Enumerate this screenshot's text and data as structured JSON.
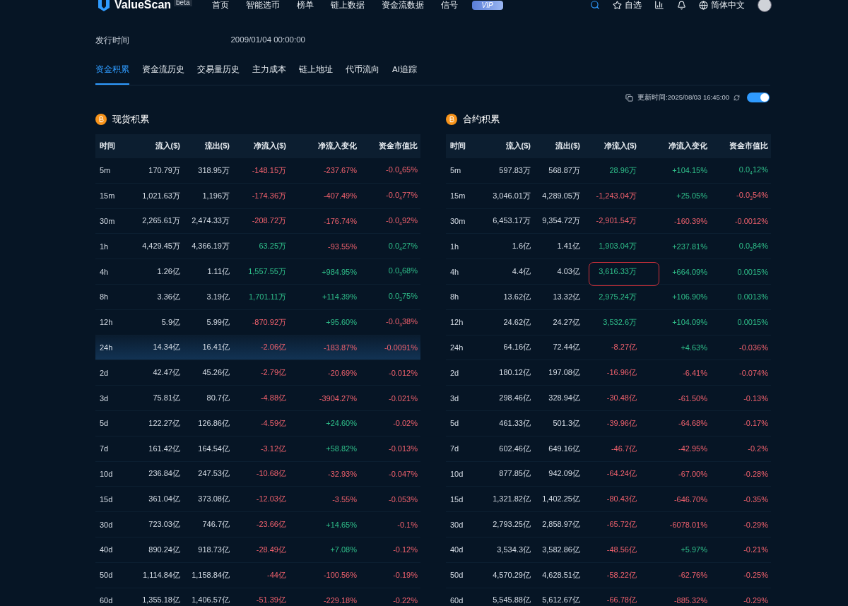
{
  "nav": {
    "brand": "ValueScan",
    "badge": "beta",
    "items": [
      {
        "label": "首页",
        "selected": false
      },
      {
        "label": "智能选币",
        "selected": false
      },
      {
        "label": "榜单",
        "selected": false
      },
      {
        "label": "链上数据",
        "selected": false
      },
      {
        "label": "资金流数据",
        "selected": false
      },
      {
        "label": "信号",
        "selected": false
      }
    ],
    "vip": "VIP",
    "watchlist": "自选",
    "language": "简体中文"
  },
  "info": {
    "label": "发行时间",
    "value": "2009/01/04 00:00:00"
  },
  "tabs": [
    {
      "label": "资金积累",
      "selected": true
    },
    {
      "label": "资金流历史",
      "selected": false
    },
    {
      "label": "交易量历史",
      "selected": false
    },
    {
      "label": "主力成本",
      "selected": false
    },
    {
      "label": "链上地址",
      "selected": false
    },
    {
      "label": "代币流向",
      "selected": false
    },
    {
      "label": "AI追踪",
      "selected": false
    }
  ],
  "update": {
    "text": "更新时间:2025/08/03 16:45:00",
    "auto_refresh": true
  },
  "tables": [
    {
      "title": "现货积累",
      "columns": [
        "时间",
        "流入($)",
        "流出($)",
        "净流入($)",
        "净流入变化",
        "资金市值比"
      ],
      "rows": [
        {
          "time": "5m",
          "inflow": "170.79万",
          "outflow": "318.95万",
          "net": "-148.15万",
          "net_up": false,
          "change": "-237.67%",
          "change_up": false,
          "ratio": "-0.0$_{4}$65%",
          "ratio_up": false,
          "selected": false,
          "circled": false
        },
        {
          "time": "15m",
          "inflow": "1,021.63万",
          "outflow": "1,196万",
          "net": "-174.36万",
          "net_up": false,
          "change": "-407.49%",
          "change_up": false,
          "ratio": "-0.0$_{4}$77%",
          "ratio_up": false,
          "selected": false,
          "circled": false
        },
        {
          "time": "30m",
          "inflow": "2,265.61万",
          "outflow": "2,474.33万",
          "net": "-208.72万",
          "net_up": false,
          "change": "-176.74%",
          "change_up": false,
          "ratio": "-0.0$_{4}$92%",
          "ratio_up": false,
          "selected": false,
          "circled": false
        },
        {
          "time": "1h",
          "inflow": "4,429.45万",
          "outflow": "4,366.19万",
          "net": "63.25万",
          "net_up": true,
          "change": "-93.55%",
          "change_up": false,
          "ratio": "0.0$_{4}$27%",
          "ratio_up": true,
          "selected": false,
          "circled": false
        },
        {
          "time": "4h",
          "inflow": "1.26亿",
          "outflow": "1.11亿",
          "net": "1,557.55万",
          "net_up": true,
          "change": "+984.95%",
          "change_up": true,
          "ratio": "0.0$_{3}$68%",
          "ratio_up": true,
          "selected": false,
          "circled": false
        },
        {
          "time": "8h",
          "inflow": "3.36亿",
          "outflow": "3.19亿",
          "net": "1,701.11万",
          "net_up": true,
          "change": "+114.39%",
          "change_up": true,
          "ratio": "0.0$_{3}$75%",
          "ratio_up": true,
          "selected": false,
          "circled": false
        },
        {
          "time": "12h",
          "inflow": "5.9亿",
          "outflow": "5.99亿",
          "net": "-870.92万",
          "net_up": false,
          "change": "+95.60%",
          "change_up": true,
          "ratio": "-0.0$_{3}$38%",
          "ratio_up": false,
          "selected": false,
          "circled": false
        },
        {
          "time": "24h",
          "inflow": "14.34亿",
          "outflow": "16.41亿",
          "net": "-2.06亿",
          "net_up": false,
          "change": "-183.87%",
          "change_up": false,
          "ratio": "-0.0091%",
          "ratio_up": false,
          "selected": true,
          "circled": false
        },
        {
          "time": "2d",
          "inflow": "42.47亿",
          "outflow": "45.26亿",
          "net": "-2.79亿",
          "net_up": false,
          "change": "-20.69%",
          "change_up": false,
          "ratio": "-0.012%",
          "ratio_up": false,
          "selected": false,
          "circled": false
        },
        {
          "time": "3d",
          "inflow": "75.81亿",
          "outflow": "80.7亿",
          "net": "-4.88亿",
          "net_up": false,
          "change": "-3904.27%",
          "change_up": false,
          "ratio": "-0.021%",
          "ratio_up": false,
          "selected": false,
          "circled": false
        },
        {
          "time": "5d",
          "inflow": "122.27亿",
          "outflow": "126.86亿",
          "net": "-4.59亿",
          "net_up": false,
          "change": "+24.60%",
          "change_up": true,
          "ratio": "-0.02%",
          "ratio_up": false,
          "selected": false,
          "circled": false
        },
        {
          "time": "7d",
          "inflow": "161.42亿",
          "outflow": "164.54亿",
          "net": "-3.12亿",
          "net_up": false,
          "change": "+58.82%",
          "change_up": true,
          "ratio": "-0.013%",
          "ratio_up": false,
          "selected": false,
          "circled": false
        },
        {
          "time": "10d",
          "inflow": "236.84亿",
          "outflow": "247.53亿",
          "net": "-10.68亿",
          "net_up": false,
          "change": "-32.93%",
          "change_up": false,
          "ratio": "-0.047%",
          "ratio_up": false,
          "selected": false,
          "circled": false
        },
        {
          "time": "15d",
          "inflow": "361.04亿",
          "outflow": "373.08亿",
          "net": "-12.03亿",
          "net_up": false,
          "change": "-3.55%",
          "change_up": false,
          "ratio": "-0.053%",
          "ratio_up": false,
          "selected": false,
          "circled": false
        },
        {
          "time": "30d",
          "inflow": "723.03亿",
          "outflow": "746.7亿",
          "net": "-23.66亿",
          "net_up": false,
          "change": "+14.65%",
          "change_up": true,
          "ratio": "-0.1%",
          "ratio_up": false,
          "selected": false,
          "circled": false
        },
        {
          "time": "40d",
          "inflow": "890.24亿",
          "outflow": "918.73亿",
          "net": "-28.49亿",
          "net_up": false,
          "change": "+7.08%",
          "change_up": true,
          "ratio": "-0.12%",
          "ratio_up": false,
          "selected": false,
          "circled": false
        },
        {
          "time": "50d",
          "inflow": "1,114.84亿",
          "outflow": "1,158.84亿",
          "net": "-44亿",
          "net_up": false,
          "change": "-100.56%",
          "change_up": false,
          "ratio": "-0.19%",
          "ratio_up": false,
          "selected": false,
          "circled": false
        },
        {
          "time": "60d",
          "inflow": "1,355.18亿",
          "outflow": "1,406.57亿",
          "net": "-51.39亿",
          "net_up": false,
          "change": "-229.18%",
          "change_up": false,
          "ratio": "-0.22%",
          "ratio_up": false,
          "selected": false,
          "circled": false
        }
      ]
    },
    {
      "title": "合约积累",
      "columns": [
        "时间",
        "流入($)",
        "流出($)",
        "净流入($)",
        "净流入变化",
        "资金市值比"
      ],
      "rows": [
        {
          "time": "5m",
          "inflow": "597.83万",
          "outflow": "568.87万",
          "net": "28.96万",
          "net_up": true,
          "change": "+104.15%",
          "change_up": true,
          "ratio": "0.0$_{4}$12%",
          "ratio_up": true,
          "selected": false,
          "circled": false
        },
        {
          "time": "15m",
          "inflow": "3,046.01万",
          "outflow": "4,289.05万",
          "net": "-1,243.04万",
          "net_up": false,
          "change": "+25.05%",
          "change_up": true,
          "ratio": "-0.0$_{3}$54%",
          "ratio_up": false,
          "selected": false,
          "circled": false
        },
        {
          "time": "30m",
          "inflow": "6,453.17万",
          "outflow": "9,354.72万",
          "net": "-2,901.54万",
          "net_up": false,
          "change": "-160.39%",
          "change_up": false,
          "ratio": "-0.0012%",
          "ratio_up": false,
          "selected": false,
          "circled": false
        },
        {
          "time": "1h",
          "inflow": "1.6亿",
          "outflow": "1.41亿",
          "net": "1,903.04万",
          "net_up": true,
          "change": "+237.81%",
          "change_up": true,
          "ratio": "0.0$_{3}$84%",
          "ratio_up": true,
          "selected": false,
          "circled": false
        },
        {
          "time": "4h",
          "inflow": "4.4亿",
          "outflow": "4.03亿",
          "net": "3,616.33万",
          "net_up": true,
          "change": "+664.09%",
          "change_up": true,
          "ratio": "0.0015%",
          "ratio_up": true,
          "selected": false,
          "circled": true
        },
        {
          "time": "8h",
          "inflow": "13.62亿",
          "outflow": "13.32亿",
          "net": "2,975.24万",
          "net_up": true,
          "change": "+106.90%",
          "change_up": true,
          "ratio": "0.0013%",
          "ratio_up": true,
          "selected": false,
          "circled": false
        },
        {
          "time": "12h",
          "inflow": "24.62亿",
          "outflow": "24.27亿",
          "net": "3,532.6万",
          "net_up": true,
          "change": "+104.09%",
          "change_up": true,
          "ratio": "0.0015%",
          "ratio_up": true,
          "selected": false,
          "circled": false
        },
        {
          "time": "24h",
          "inflow": "64.16亿",
          "outflow": "72.44亿",
          "net": "-8.27亿",
          "net_up": false,
          "change": "+4.63%",
          "change_up": true,
          "ratio": "-0.036%",
          "ratio_up": false,
          "selected": false,
          "circled": false
        },
        {
          "time": "2d",
          "inflow": "180.12亿",
          "outflow": "197.08亿",
          "net": "-16.96亿",
          "net_up": false,
          "change": "-6.41%",
          "change_up": false,
          "ratio": "-0.074%",
          "ratio_up": false,
          "selected": false,
          "circled": false
        },
        {
          "time": "3d",
          "inflow": "298.46亿",
          "outflow": "328.94亿",
          "net": "-30.48亿",
          "net_up": false,
          "change": "-61.50%",
          "change_up": false,
          "ratio": "-0.13%",
          "ratio_up": false,
          "selected": false,
          "circled": false
        },
        {
          "time": "5d",
          "inflow": "461.33亿",
          "outflow": "501.3亿",
          "net": "-39.96亿",
          "net_up": false,
          "change": "-64.68%",
          "change_up": false,
          "ratio": "-0.17%",
          "ratio_up": false,
          "selected": false,
          "circled": false
        },
        {
          "time": "7d",
          "inflow": "602.46亿",
          "outflow": "649.16亿",
          "net": "-46.7亿",
          "net_up": false,
          "change": "-42.95%",
          "change_up": false,
          "ratio": "-0.2%",
          "ratio_up": false,
          "selected": false,
          "circled": false
        },
        {
          "time": "10d",
          "inflow": "877.85亿",
          "outflow": "942.09亿",
          "net": "-64.24亿",
          "net_up": false,
          "change": "-67.00%",
          "change_up": false,
          "ratio": "-0.28%",
          "ratio_up": false,
          "selected": false,
          "circled": false
        },
        {
          "time": "15d",
          "inflow": "1,321.82亿",
          "outflow": "1,402.25亿",
          "net": "-80.43亿",
          "net_up": false,
          "change": "-646.70%",
          "change_up": false,
          "ratio": "-0.35%",
          "ratio_up": false,
          "selected": false,
          "circled": false
        },
        {
          "time": "30d",
          "inflow": "2,793.25亿",
          "outflow": "2,858.97亿",
          "net": "-65.72亿",
          "net_up": false,
          "change": "-6078.01%",
          "change_up": false,
          "ratio": "-0.29%",
          "ratio_up": false,
          "selected": false,
          "circled": false
        },
        {
          "time": "40d",
          "inflow": "3,534.3亿",
          "outflow": "3,582.86亿",
          "net": "-48.56亿",
          "net_up": false,
          "change": "+5.97%",
          "change_up": true,
          "ratio": "-0.21%",
          "ratio_up": false,
          "selected": false,
          "circled": false
        },
        {
          "time": "50d",
          "inflow": "4,570.29亿",
          "outflow": "4,628.51亿",
          "net": "-58.22亿",
          "net_up": false,
          "change": "-62.76%",
          "change_up": false,
          "ratio": "-0.25%",
          "ratio_up": false,
          "selected": false,
          "circled": false
        },
        {
          "time": "60d",
          "inflow": "5,545.88亿",
          "outflow": "5,612.67亿",
          "net": "-66.78亿",
          "net_up": false,
          "change": "-885.32%",
          "change_up": false,
          "ratio": "-0.29%",
          "ratio_up": false,
          "selected": false,
          "circled": false
        }
      ]
    }
  ]
}
